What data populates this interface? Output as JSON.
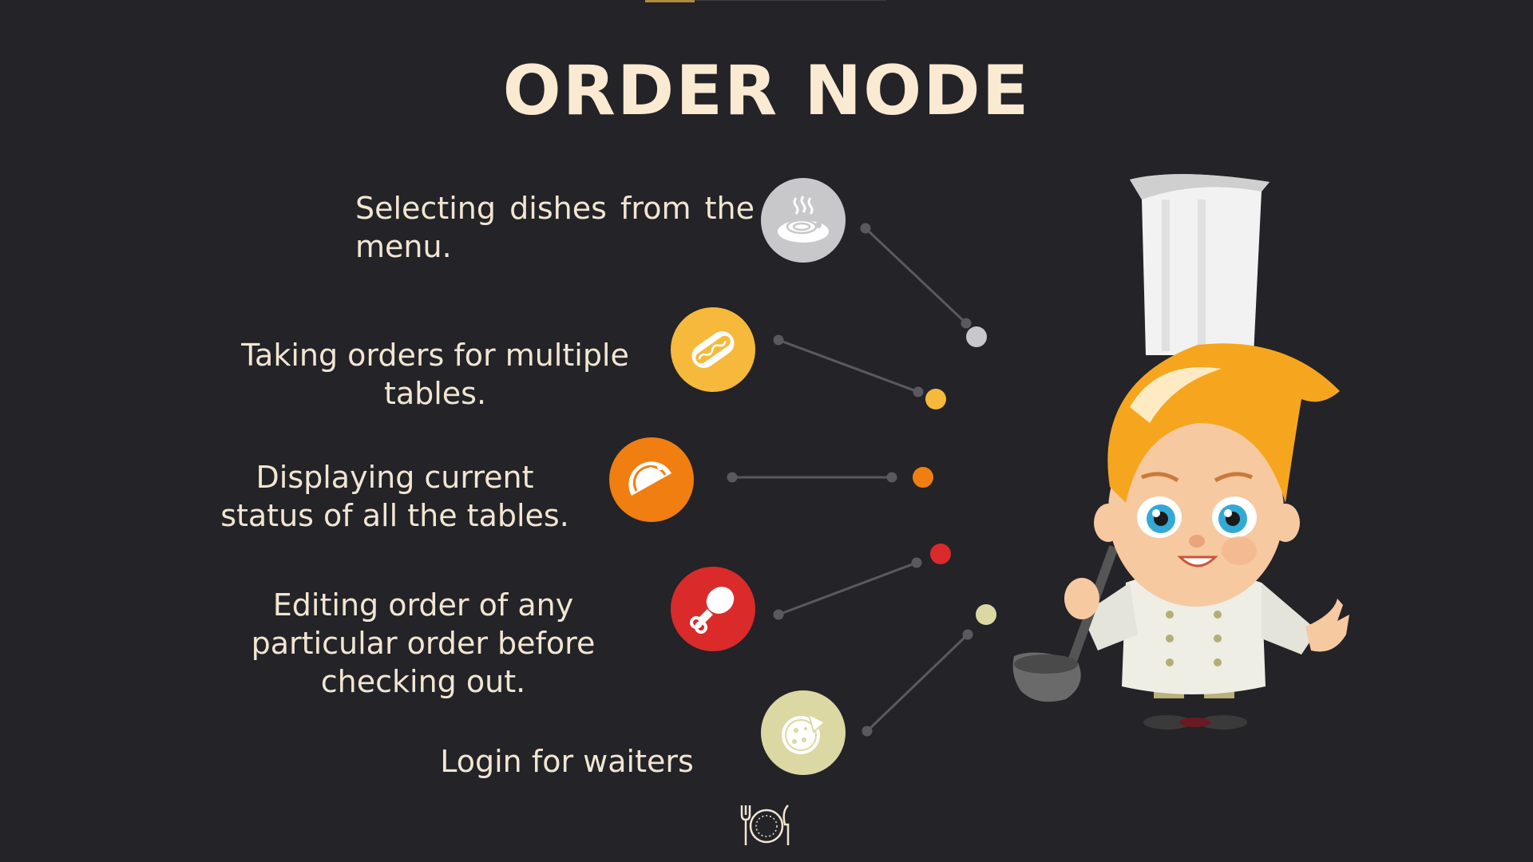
{
  "page": {
    "title": "ORDER NODE"
  },
  "features": [
    {
      "text": "Selecting dishes from the menu.",
      "icon": "noodles-bowl-icon",
      "color": "#c8c8ca"
    },
    {
      "text": "Taking orders for multiple tables.",
      "icon": "hotdog-icon",
      "color": "#f6b93b"
    },
    {
      "text": "Displaying current status of all the tables.",
      "icon": "taco-icon",
      "color": "#f07e10"
    },
    {
      "text": "Editing order of any particular order before checking out.",
      "icon": "chicken-leg-icon",
      "color": "#da2a2a"
    },
    {
      "text": "Login for waiters",
      "icon": "pizza-icon",
      "color": "#dcd8a4"
    }
  ],
  "illustration": {
    "icon": "chef-with-ladle-illustration"
  },
  "footer": {
    "icon": "plate-fork-knife-icon"
  },
  "colors": {
    "background": "#232328",
    "title": "#fbead2",
    "text": "#f2e6d2",
    "connector": "#5a5a5e"
  }
}
